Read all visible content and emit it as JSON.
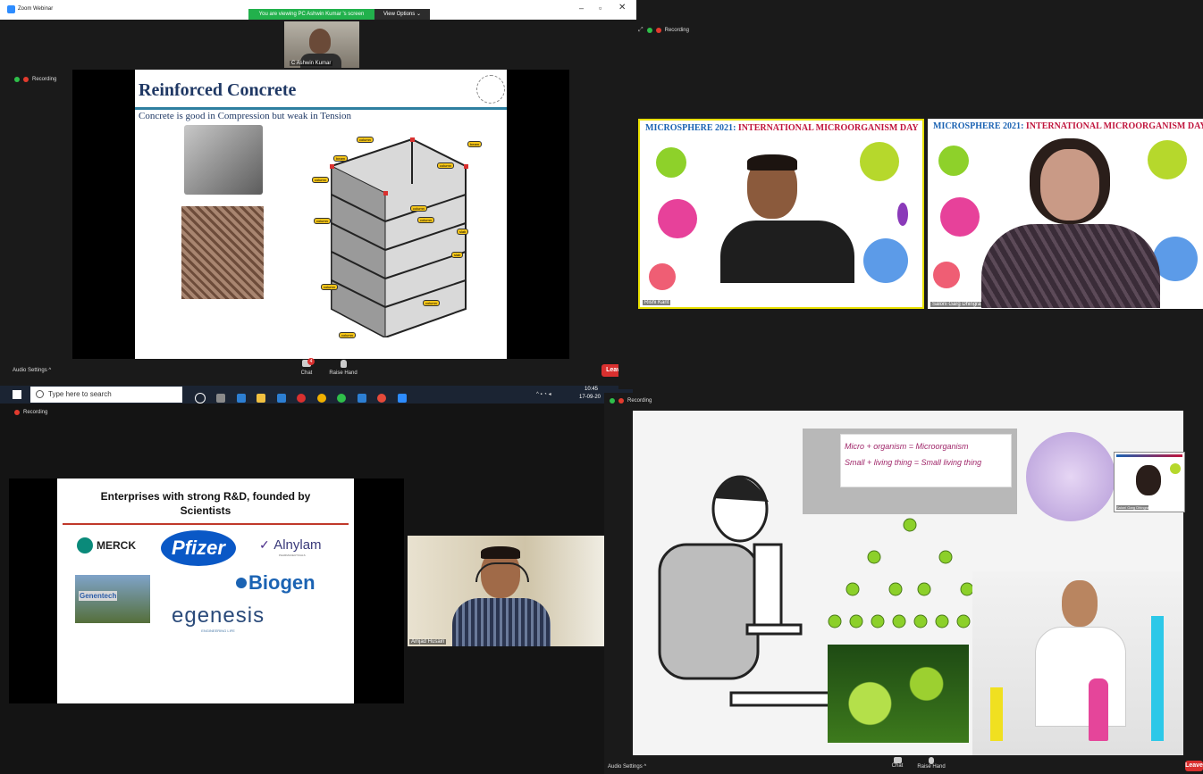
{
  "window": {
    "title": "Zoom Webinar",
    "share_banner": "You are viewing PC Ashwin Kumar 's screen",
    "view_options": "View Options ⌄"
  },
  "q1": {
    "recording": "Recording",
    "speaker_name": "C Ashwin Kumar",
    "slide_title": "Reinforced Concrete",
    "slide_subtitle": "Concrete is good in Compression but weak in Tension",
    "building_tags": [
      "column",
      "beam",
      "column",
      "beam",
      "column",
      "column",
      "column",
      "column",
      "slab",
      "slab",
      "column",
      "column",
      "column"
    ],
    "audio_settings": "Audio Settings ^",
    "chat": "Chat",
    "chat_badge": "4",
    "raise_hand": "Raise Hand",
    "leave": "Leave"
  },
  "taskbar": {
    "search_placeholder": "Type here to search",
    "time": "10:45",
    "date": "17-09-20"
  },
  "q2": {
    "recording": "Recording",
    "banner_left": "MICROSPHERE 2021",
    "banner_right": "INTERNATIONAL MICROORGANISM DAY",
    "tile1_name": "Rishi Kant",
    "tile2_name": "Saloni Garg Dhingra"
  },
  "q3": {
    "recording": "Recording",
    "slide_title": "Enterprises with strong R&D, founded by Scientists",
    "logos": {
      "merck": "MERCK",
      "pfizer": "Pfizer",
      "alnylam": "Alnylam",
      "alnylam_sub": "PHARMACEUTICALS",
      "genentech": "Genentech",
      "biogen": "Biogen",
      "egenesis": "egenesis",
      "egenesis_sub": "ENGINEERING LIFE"
    },
    "speaker_name": "Amjad Husain"
  },
  "q4": {
    "recording": "Recording",
    "eq1": "Micro + organism = Microorganism",
    "eq2": "Small + living thing = Small living thing",
    "pip_name": "Saloni Garg Dhingra",
    "audio_settings": "Audio Settings ^",
    "chat": "Chat",
    "raise_hand": "Raise Hand",
    "leave": "Leave"
  },
  "colors": {
    "leave_red": "#d9302f",
    "zoom_green": "#2fbf4a",
    "slide_navy": "#1f3864",
    "biogen_blue": "#1b63b3",
    "pfizer_blue": "#0a58c6"
  }
}
